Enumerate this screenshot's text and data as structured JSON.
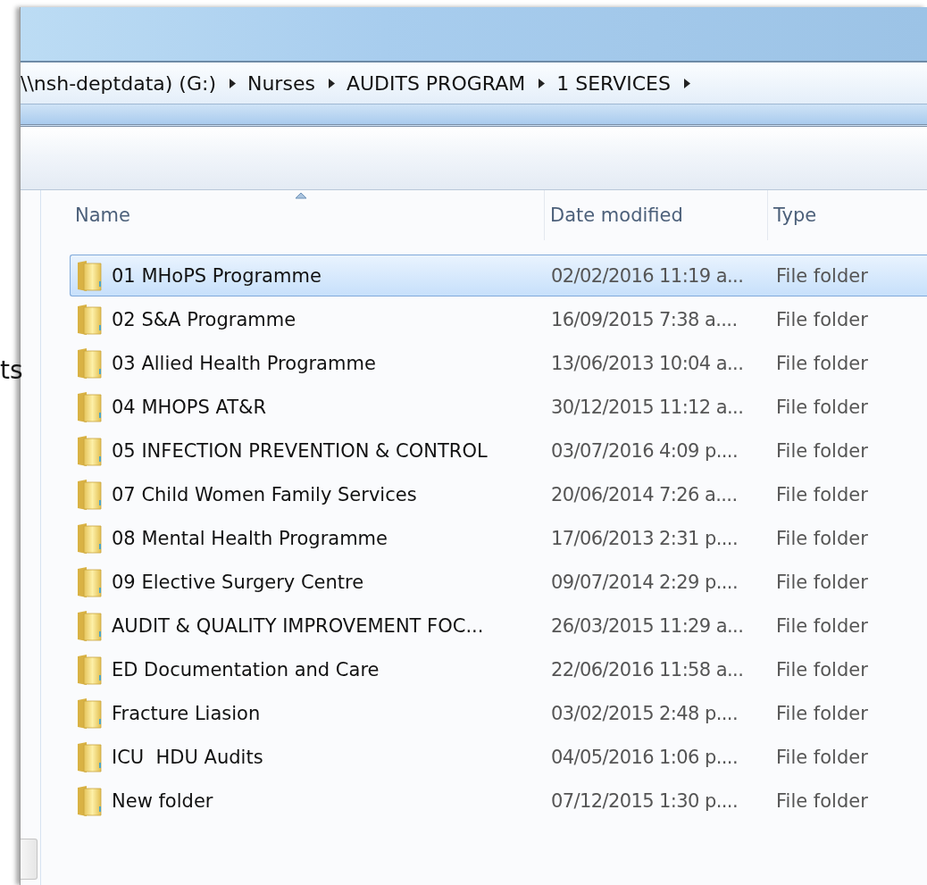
{
  "address_bar": {
    "crumbs": [
      "\\\\nsh-deptdata) (G:)",
      "Nurses",
      "AUDITS PROGRAM",
      "1 SERVICES"
    ]
  },
  "side_text": "ts",
  "columns": [
    {
      "label": "Name",
      "sorted": true
    },
    {
      "label": "Date modified",
      "sorted": false
    },
    {
      "label": "Type",
      "sorted": false
    }
  ],
  "rows": [
    {
      "name": "01 MHoPS Programme",
      "date": "02/02/2016 11:19 a...",
      "type": "File folder",
      "selected": true
    },
    {
      "name": "02 S&A Programme",
      "date": "16/09/2015 7:38 a....",
      "type": "File folder",
      "selected": false
    },
    {
      "name": "03 Allied Health Programme",
      "date": "13/06/2013 10:04 a...",
      "type": "File folder",
      "selected": false
    },
    {
      "name": "04 MHOPS AT&R",
      "date": "30/12/2015 11:12 a...",
      "type": "File folder",
      "selected": false
    },
    {
      "name": "05 INFECTION PREVENTION & CONTROL",
      "date": "03/07/2016 4:09 p....",
      "type": "File folder",
      "selected": false
    },
    {
      "name": "07 Child Women Family Services",
      "date": "20/06/2014 7:26 a....",
      "type": "File folder",
      "selected": false
    },
    {
      "name": "08 Mental Health Programme",
      "date": "17/06/2013 2:31 p....",
      "type": "File folder",
      "selected": false
    },
    {
      "name": "09 Elective Surgery Centre",
      "date": "09/07/2014 2:29 p....",
      "type": "File folder",
      "selected": false
    },
    {
      "name": "AUDIT & QUALITY IMPROVEMENT FOC...",
      "date": "26/03/2015 11:29 a...",
      "type": "File folder",
      "selected": false
    },
    {
      "name": "ED Documentation and Care",
      "date": "22/06/2016 11:58 a...",
      "type": "File folder",
      "selected": false
    },
    {
      "name": "Fracture Liasion",
      "date": "03/02/2015 2:48 p....",
      "type": "File folder",
      "selected": false
    },
    {
      "name": "ICU  HDU Audits",
      "date": "04/05/2016 1:06 p....",
      "type": "File folder",
      "selected": false
    },
    {
      "name": "New folder",
      "date": "07/12/2015 1:30 p....",
      "type": "File folder",
      "selected": false
    }
  ]
}
